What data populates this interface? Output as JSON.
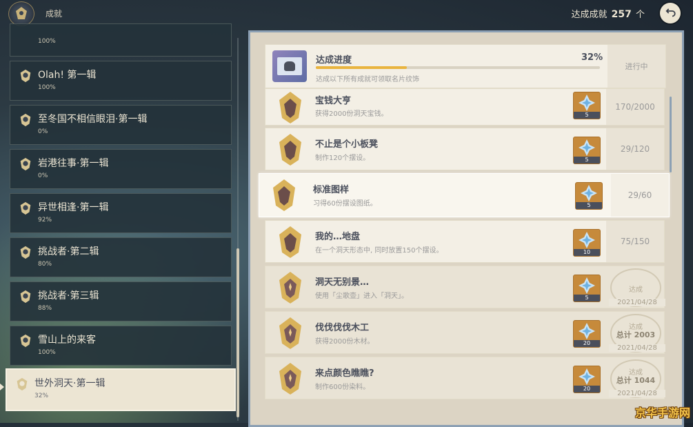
{
  "header": {
    "title": "成就",
    "achieved_label": "达成成就",
    "achieved_count": "257",
    "achieved_unit": "个"
  },
  "categories": [
    {
      "name": "",
      "pct": "100%"
    },
    {
      "name": "Olah! 第一辑",
      "pct": "100%"
    },
    {
      "name": "至冬国不相信眼泪·第一辑",
      "pct": "0%"
    },
    {
      "name": "岩港往事·第一辑",
      "pct": "0%"
    },
    {
      "name": "异世相逢·第一辑",
      "pct": "92%"
    },
    {
      "name": "挑战者·第二辑",
      "pct": "80%"
    },
    {
      "name": "挑战者·第三辑",
      "pct": "88%"
    },
    {
      "name": "雪山上的来客",
      "pct": "100%"
    },
    {
      "name": "世外洞天·第一辑",
      "pct": "32%"
    }
  ],
  "progress": {
    "title": "达成进度",
    "percent_label": "32%",
    "percent_value": 0.32,
    "desc": "达成以下所有成就可领取名片纹饰",
    "status": "进行中"
  },
  "achievements": [
    {
      "name": "宝钱大亨",
      "desc": "获得2000份洞天宝钱。",
      "reward_qty": "5",
      "progress": "170/2000"
    },
    {
      "name": "不止是个小板凳",
      "desc": "制作120个摆设。",
      "reward_qty": "5",
      "progress": "29/120"
    },
    {
      "name": "标准图样",
      "desc": "习得60份摆设图纸。",
      "reward_qty": "5",
      "progress": "29/60"
    },
    {
      "name": "我的…地盘",
      "desc": "在一个洞天形态中, 同时放置150个摆设。",
      "reward_qty": "10",
      "progress": "75/150"
    },
    {
      "name": "洞天无别景…",
      "desc": "使用「尘歌壶」进入「洞天」。",
      "reward_qty": "5",
      "stamp_top": "达成",
      "stamp_total": "",
      "stamp_date": "2021/04/28"
    },
    {
      "name": "伐伐伐伐木工",
      "desc": "获得2000份木材。",
      "reward_qty": "20",
      "stamp_top": "达成",
      "stamp_total": "总计 2003",
      "stamp_date": "2021/04/28"
    },
    {
      "name": "来点颜色瞧瞧?",
      "desc": "制作600份染料。",
      "reward_qty": "20",
      "stamp_top": "达成",
      "stamp_total": "总计 1044",
      "stamp_date": "2021/04/28"
    }
  ],
  "watermark": "京华手游网",
  "colors": {
    "accent": "#e9b43e",
    "card": "#f3efe5",
    "text": "#4a4f5c",
    "reward_bg": "#c68a3b"
  }
}
